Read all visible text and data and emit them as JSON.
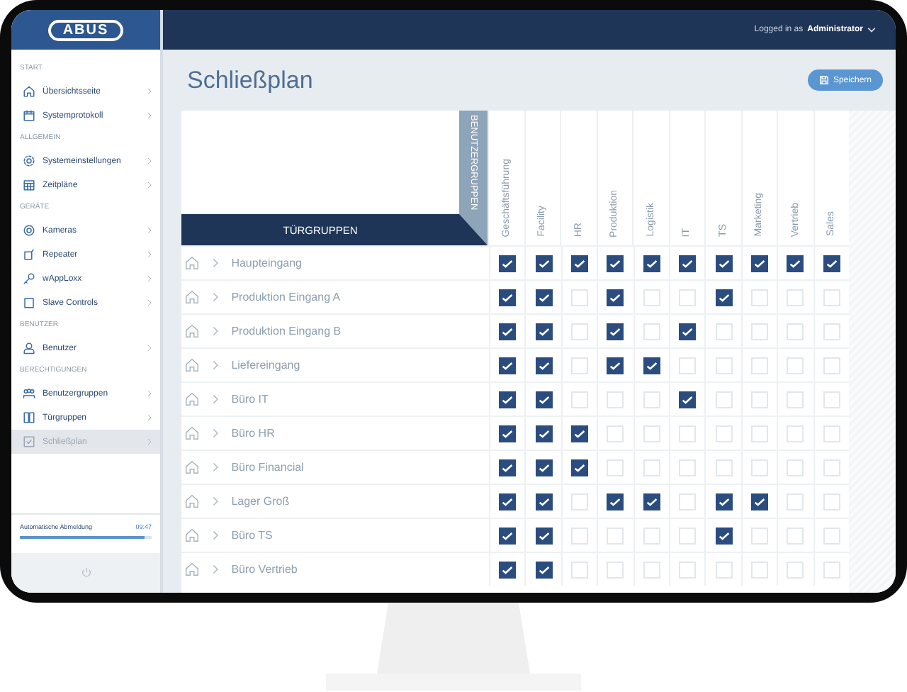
{
  "logo": "ABUS",
  "header": {
    "user_prefix": "Logged in as",
    "user_name": "Administrator"
  },
  "sidebar": {
    "sections": [
      {
        "title": "START",
        "items": [
          {
            "label": "Übersichtsseite",
            "selected": false
          },
          {
            "label": "Systemprotokoll",
            "selected": false
          }
        ]
      },
      {
        "title": "ALLGEMEIN",
        "items": [
          {
            "label": "Systemeinstellungen",
            "selected": false
          },
          {
            "label": "Zeitpläne",
            "selected": false
          }
        ]
      },
      {
        "title": "GERÄTE",
        "items": [
          {
            "label": "Kameras",
            "selected": false
          },
          {
            "label": "Repeater",
            "selected": false
          },
          {
            "label": "wAppLoxx",
            "selected": false
          },
          {
            "label": "Slave Controls",
            "selected": false
          }
        ]
      },
      {
        "title": "BENUTZER",
        "items": [
          {
            "label": "Benutzer",
            "selected": false
          }
        ]
      },
      {
        "title": "BERECHTIGUNGEN",
        "items": [
          {
            "label": "Benutzergruppen",
            "selected": false
          },
          {
            "label": "Türgruppen",
            "selected": false
          },
          {
            "label": "Schließplan",
            "selected": true
          }
        ]
      }
    ],
    "logout": {
      "label": "Automatische Abmeldung",
      "time": "09:47",
      "level": 0.95
    }
  },
  "page": {
    "title": "Schließplan",
    "save_button": "Speichern"
  },
  "table": {
    "row_header": "TÜRGRUPPEN",
    "column_header": "BENUTZERGRUPPEN",
    "columns": [
      "Geschäftsführung",
      "Facility",
      "HR",
      "Produktion",
      "Logistik",
      "IT",
      "TS",
      "Marketing",
      "Vertrieb",
      "Sales"
    ],
    "rows": [
      {
        "name": "Haupteingang",
        "checked": [
          true,
          true,
          true,
          true,
          true,
          true,
          true,
          true,
          true,
          true
        ]
      },
      {
        "name": "Produktion Eingang A",
        "checked": [
          true,
          true,
          false,
          true,
          false,
          false,
          true,
          false,
          false,
          false
        ]
      },
      {
        "name": "Produktion Eingang B",
        "checked": [
          true,
          true,
          false,
          true,
          false,
          true,
          false,
          false,
          false,
          false
        ]
      },
      {
        "name": "Liefereingang",
        "checked": [
          true,
          true,
          false,
          true,
          true,
          false,
          false,
          false,
          false,
          false
        ]
      },
      {
        "name": "Büro IT",
        "checked": [
          true,
          true,
          false,
          false,
          false,
          true,
          false,
          false,
          false,
          false
        ]
      },
      {
        "name": "Büro HR",
        "checked": [
          true,
          true,
          true,
          false,
          false,
          false,
          false,
          false,
          false,
          false
        ]
      },
      {
        "name": "Büro Financial",
        "checked": [
          true,
          true,
          true,
          false,
          false,
          false,
          false,
          false,
          false,
          false
        ]
      },
      {
        "name": "Lager Groß",
        "checked": [
          true,
          true,
          false,
          true,
          true,
          false,
          true,
          true,
          false,
          false
        ]
      },
      {
        "name": "Büro TS",
        "checked": [
          true,
          true,
          false,
          false,
          false,
          false,
          true,
          false,
          false,
          false
        ]
      },
      {
        "name": "Büro Vertrieb",
        "checked": [
          true,
          true,
          false,
          false,
          false,
          false,
          false,
          false,
          false,
          false
        ]
      }
    ]
  }
}
